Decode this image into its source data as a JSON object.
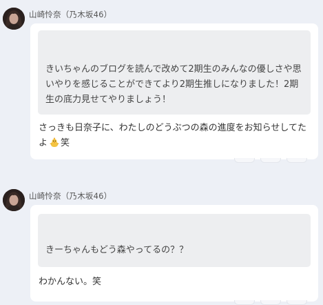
{
  "messages": [
    {
      "sender": "山崎怜奈（乃木坂46）",
      "avatar_icon": "profile-photo",
      "quote_text": "きいちゃんのブログを読んで改めて2期生のみんなの優しさや思いやりを感じることができてより2期生推しになりました！2期生の底力見せてやりましょう！",
      "reply_text": "さっきも日奈子に、わたしのどうぶつの森の進度をお知らせしてたよ",
      "reply_emoji": "chick-emoji",
      "reply_suffix": "笑"
    },
    {
      "sender": "山崎怜奈（乃木坂46）",
      "avatar_icon": "profile-photo",
      "quote_text": "きーちゃんもどう森やってるの？？",
      "reply_text": "わかんない。笑"
    }
  ],
  "colors": {
    "background": "#edf0f6",
    "card": "#ffffff",
    "quote_background": "#edeef0",
    "text": "#333333"
  }
}
